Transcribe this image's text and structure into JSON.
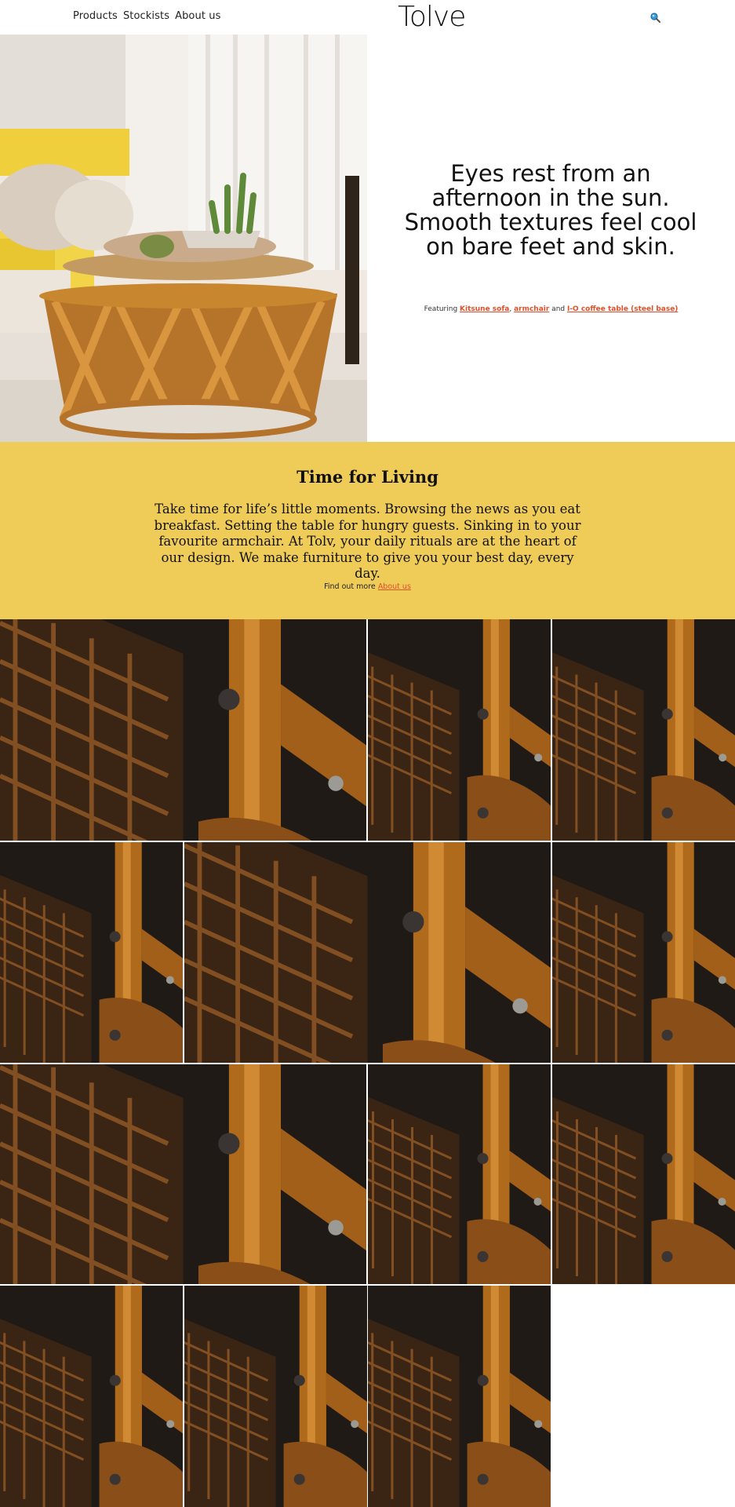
{
  "header": {
    "nav": [
      "Products",
      "Stockists",
      "About us"
    ],
    "logo": "Tolve",
    "search_icon": "search-icon"
  },
  "hero": {
    "headline": "Eyes rest from an afternoon in the sun. Smooth textures feel cool on bare feet and skin.",
    "featuring_prefix": "Featuring ",
    "link1": "Kitsune sofa",
    "sep1": ", ",
    "link2": "armchair",
    "sep2": " and ",
    "link3": "I-O coffee table (steel base)"
  },
  "band": {
    "title": "Time for Living",
    "body": "Take time for life’s little moments. Browsing the news as you eat breakfast. Setting the table for hungry guests. Sinking in to your favourite armchair. At Tolv, your daily rituals are at the heart of our design. We make furniture to give you your best day, every day.",
    "more_prefix": "Find out more ",
    "more_link": "About us"
  },
  "colors": {
    "band": "#efcb57",
    "link": "#e0502a",
    "wood": "#b06a1c",
    "dark": "#1f1a16"
  }
}
